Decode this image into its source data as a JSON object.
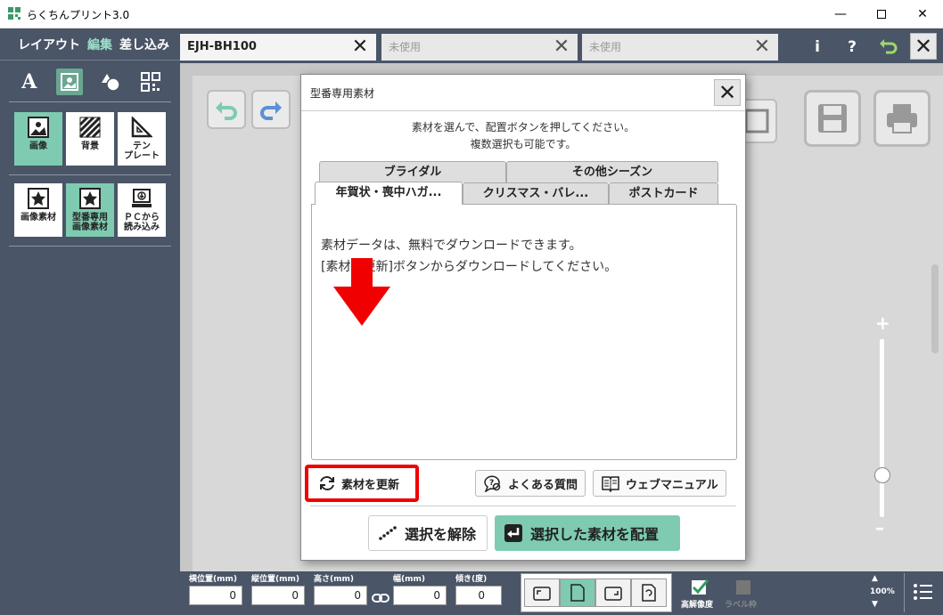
{
  "window": {
    "title": "らくちんプリント3.0",
    "controls": [
      "minimize",
      "maximize",
      "close"
    ]
  },
  "modes": {
    "layout": "レイアウト",
    "edit": "編集",
    "merge": "差し込み"
  },
  "tools": [
    "text-icon",
    "image-icon",
    "shape-icon",
    "qrcode-icon"
  ],
  "tiles_row1": [
    {
      "label": "画像",
      "icon": "image-icon"
    },
    {
      "label": "背景",
      "icon": "background-icon"
    },
    {
      "label": "テン\nプレート",
      "icon": "template-icon"
    }
  ],
  "tiles_row2": [
    {
      "label": "画像素材",
      "icon": "star-image-icon"
    },
    {
      "label": "型番専用\n画像素材",
      "icon": "star-image-icon"
    },
    {
      "label": "ＰＣから\n読み込み",
      "icon": "pc-icon"
    }
  ],
  "tabs": [
    {
      "label": "EJH-BH100"
    },
    {
      "label": "未使用"
    },
    {
      "label": "未使用"
    }
  ],
  "top_icons": {
    "info": "i",
    "help": "?"
  },
  "bottom": {
    "fields": [
      {
        "label": "横位置(mm)",
        "value": "0"
      },
      {
        "label": "縦位置(mm)",
        "value": "0"
      },
      {
        "label": "高さ(mm)",
        "value": "0"
      },
      {
        "label": "幅(mm)",
        "value": "0"
      },
      {
        "label": "傾き(度)",
        "value": "0"
      }
    ],
    "high_res": "高解像度",
    "label_frame": "ラベル枠",
    "zoom": "100%"
  },
  "dialog": {
    "title": "型番専用素材",
    "instruction1": "素材を選んで、配置ボタンを押してください。",
    "instruction2": "複数選択も可能です。",
    "tabs_back": [
      "ブライダル",
      "その他シーズン"
    ],
    "tabs_front": [
      "年賀状・喪中ハガ...",
      "クリスマス・バレ...",
      "ポストカード"
    ],
    "message1": "素材データは、無料でダウンロードできます。",
    "message2": "[素材を更新]ボタンからダウンロードしてください。",
    "update_button": "素材を更新",
    "faq_button": "よくある質問",
    "manual_button": "ウェブマニュアル",
    "deselect_button": "選択を解除",
    "place_button": "選択した素材を配置"
  },
  "colors": {
    "sidebar": "#4a5567",
    "accent": "#7ecbb1",
    "highlight": "#f00000"
  }
}
